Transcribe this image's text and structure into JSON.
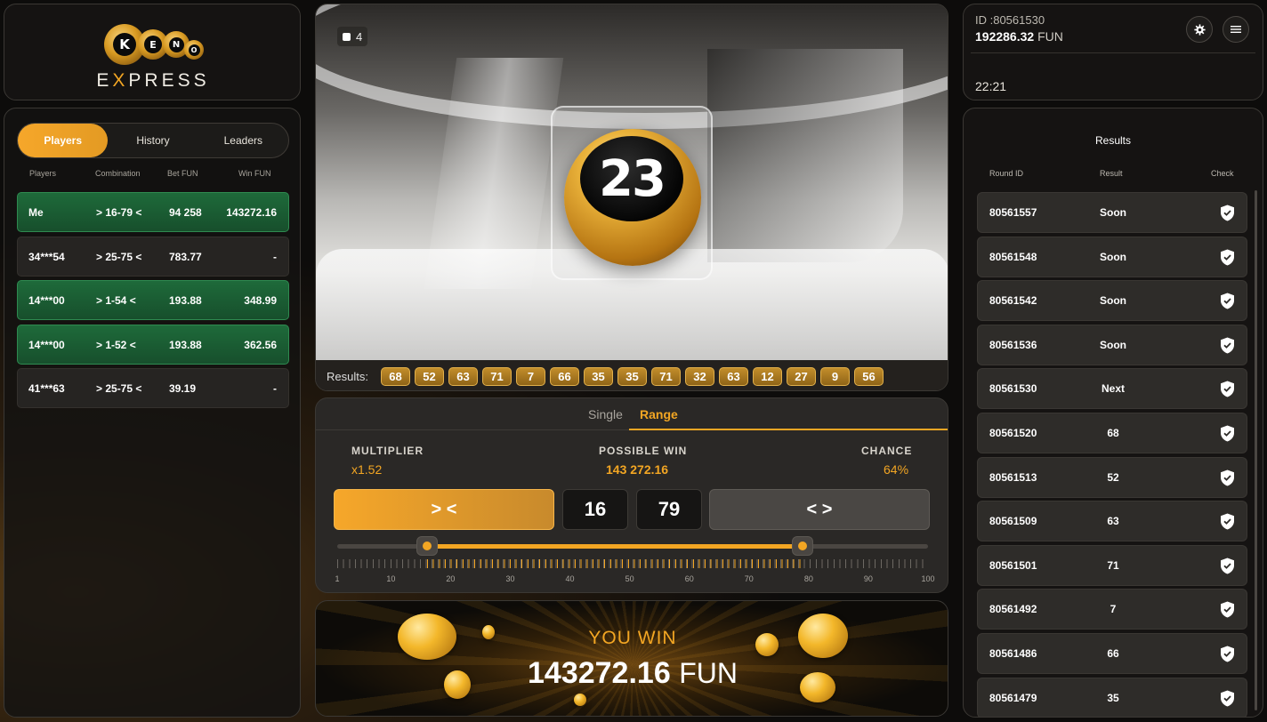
{
  "logo": {
    "letters": [
      "K",
      "E",
      "N",
      "O"
    ],
    "word_pre": "E",
    "word_x": "X",
    "word_post": "PRESS"
  },
  "players_tabs": [
    "Players",
    "History",
    "Leaders"
  ],
  "players_headers": [
    "Players",
    "Combination",
    "Bet FUN",
    "Win FUN"
  ],
  "players": [
    {
      "name": "Me",
      "combo": "> 16-79 <",
      "bet": "94 258",
      "win": "143272.16",
      "won": true
    },
    {
      "name": "34***54",
      "combo": "> 25-75 <",
      "bet": "783.77",
      "win": "-",
      "won": false
    },
    {
      "name": "14***00",
      "combo": "> 1-54 <",
      "bet": "193.88",
      "win": "348.99",
      "won": true
    },
    {
      "name": "14***00",
      "combo": "> 1-52 <",
      "bet": "193.88",
      "win": "362.56",
      "won": true
    },
    {
      "name": "41***63",
      "combo": "> 25-75 <",
      "bet": "39.19",
      "win": "-",
      "won": false
    }
  ],
  "video": {
    "camera_count": "4",
    "ball_number": "23"
  },
  "results_label": "Results:",
  "recent_results": [
    "68",
    "52",
    "63",
    "71",
    "7",
    "66",
    "35",
    "35",
    "71",
    "32",
    "63",
    "12",
    "27",
    "9",
    "56"
  ],
  "bet": {
    "mode_single": "Single",
    "mode_range": "Range",
    "multiplier_label": "MULTIPLIER",
    "multiplier": "x1.52",
    "possible_win_label": "POSSIBLE WIN",
    "possible_win": "143 272.16",
    "chance_label": "CHANCE",
    "chance": "64%",
    "range_in_label": "> <",
    "range_out_label": "< >",
    "range_low": "16",
    "range_high": "79",
    "slider_min": 1,
    "slider_max": 100,
    "tick_labels": [
      "1",
      "10",
      "20",
      "30",
      "40",
      "50",
      "60",
      "70",
      "80",
      "90",
      "100"
    ]
  },
  "win": {
    "title": "YOU WIN",
    "amount": "143272.16",
    "currency": "FUN"
  },
  "account": {
    "id": "ID :80561530",
    "balance": "192286.32",
    "currency": "FUN",
    "time": "22:21"
  },
  "results_panel": {
    "title": "Results",
    "headers": [
      "Round ID",
      "Result",
      "Check"
    ],
    "rows": [
      {
        "round": "80561557",
        "result": "Soon"
      },
      {
        "round": "80561548",
        "result": "Soon"
      },
      {
        "round": "80561542",
        "result": "Soon"
      },
      {
        "round": "80561536",
        "result": "Soon"
      },
      {
        "round": "80561530",
        "result": "Next"
      },
      {
        "round": "80561520",
        "result": "68"
      },
      {
        "round": "80561513",
        "result": "52"
      },
      {
        "round": "80561509",
        "result": "63"
      },
      {
        "round": "80561501",
        "result": "71"
      },
      {
        "round": "80561492",
        "result": "7"
      },
      {
        "round": "80561486",
        "result": "66"
      },
      {
        "round": "80561479",
        "result": "35"
      }
    ]
  },
  "colors": {
    "accent": "#f3a623",
    "win_row": "#1e6a3a",
    "panel": "#161513"
  }
}
